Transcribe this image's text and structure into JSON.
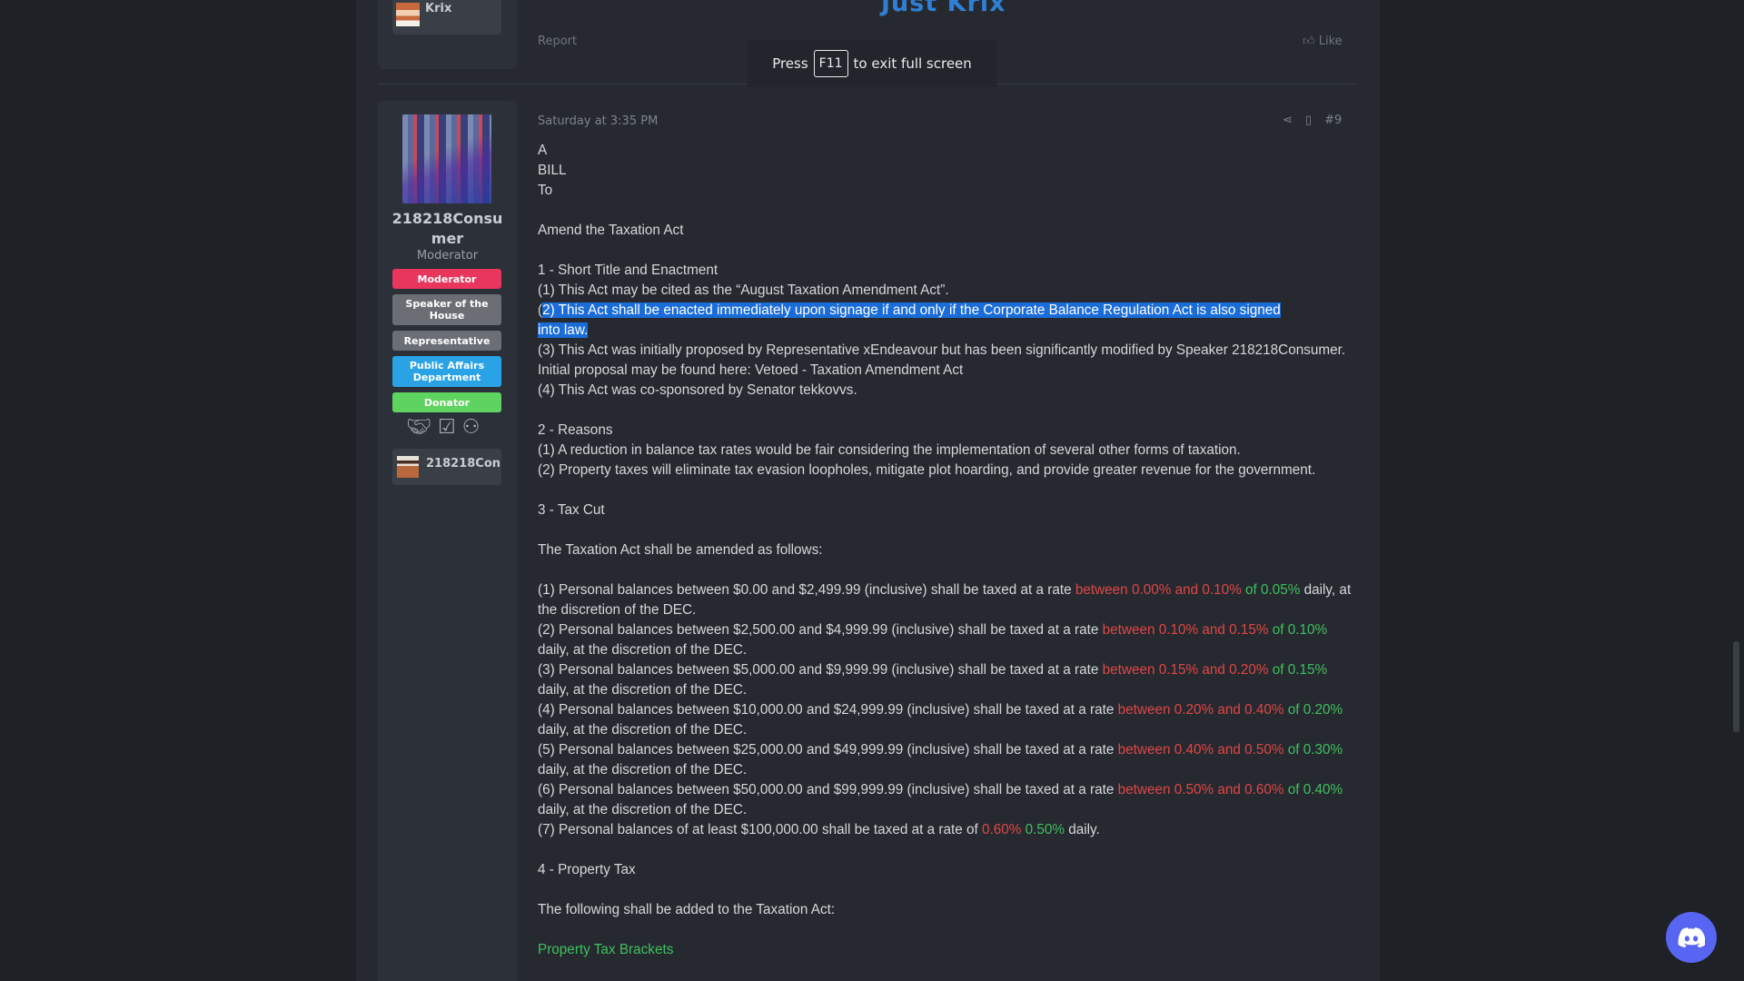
{
  "previous_post": {
    "title": "Just Krix",
    "user_name": "Krix",
    "report_label": "Report",
    "like_label": "Like"
  },
  "fullscreen_toast": {
    "pre": "Press",
    "key": "F11",
    "post": "to exit full screen"
  },
  "user": {
    "name": "218218Consumer",
    "title": "Moderator",
    "banners": [
      {
        "label": "Moderator",
        "color": "#e8365d"
      },
      {
        "label": "Speaker of the House",
        "color": "#6b6f75"
      },
      {
        "label": "Representative",
        "color": "#6b6f75"
      },
      {
        "label": "Public Affairs Department",
        "color": "#2aa3e6"
      },
      {
        "label": "Donator",
        "color": "#5fd35f"
      }
    ],
    "trophy_icons": [
      "handshake-icon",
      "ballot-icon",
      "people-icon"
    ],
    "account_name": "218218Con"
  },
  "post": {
    "date": "Saturday at 3:35 PM",
    "number": "#9",
    "lines": {
      "a": "A",
      "bill": "BILL",
      "to": "To",
      "amend": "Amend the Taxation Act",
      "s1_title": "1 - Short Title and Enactment",
      "s1_1": "(1) This Act may be cited as the “August Taxation Amendment Act”.",
      "s1_2_a": "(",
      "s1_2_b": "2) This Act shall be enacted immediately upon signage if and only if the Corporate Balance Regulation Act is also signed",
      "s1_2_c": "into law.",
      "s1_3": "(3) This Act was initially proposed by Representative xEndeavour but has been significantly modified by Speaker 218218Consumer. Initial proposal may be found here: Vetoed - Taxation Amendment Act",
      "s1_4": "(4) This Act was co-sponsored by Senator tekkovvs.",
      "s2_title": "2 - Reasons",
      "s2_1": "(1) A reduction in balance tax rates would be fair considering the implementation of several other forms of taxation.",
      "s2_2": "(2) Property taxes will eliminate tax evasion loopholes, mitigate plot hoarding, and provide greater revenue for the government.",
      "s3_title": "3 - Tax Cut",
      "s3_intro": "The Taxation Act shall be amended as follows:",
      "s4_title": "4 - Property Tax",
      "s4_intro": "The following shall be added to the Taxation Act:",
      "s4_link": "Property Tax Brackets"
    },
    "tax_rows": [
      {
        "pre": "(1) Personal balances between $0.00 and $2,499.99 (inclusive) shall be taxed at a rate ",
        "red": "between 0.00% and 0.10%",
        "green": " of 0.05%",
        "post": " daily, at the discretion of the DEC."
      },
      {
        "pre": "(2) Personal balances between $2,500.00 and $4,999.99 (inclusive) shall be taxed at a rate ",
        "red": "between 0.10% and 0.15%",
        "green": " of 0.10%",
        "post": " daily, at the discretion of the DEC."
      },
      {
        "pre": "(3) Personal balances between $5,000.00 and $9,999.99 (inclusive) shall be taxed at a rate ",
        "red": "between 0.15% and 0.20%",
        "green": " of 0.15%",
        "post": " daily, at the discretion of the DEC."
      },
      {
        "pre": "(4) Personal balances between $10,000.00 and $24,999.99 (inclusive) shall be taxed at a rate ",
        "red": "between 0.20% and 0.40%",
        "green": " of 0.20%",
        "post": " daily, at the discretion of the DEC."
      },
      {
        "pre": "(5) Personal balances between $25,000.00 and $49,999.99 (inclusive) shall be taxed at a rate ",
        "red": "between 0.40% and 0.50%",
        "green": " of 0.30%",
        "post": " daily, at the discretion of the DEC."
      },
      {
        "pre": "(6) Personal balances between $50,000.00 and $99,999.99 (inclusive) shall be taxed at a rate ",
        "red": "between 0.50% and 0.60%",
        "green": " of 0.40%",
        "post": " daily, at the discretion of the DEC."
      },
      {
        "pre": "(7) Personal balances of at least $100,000.00 shall be taxed at a rate of ",
        "red": "0.60%",
        "green": " 0.50%",
        "post": " daily."
      }
    ]
  }
}
